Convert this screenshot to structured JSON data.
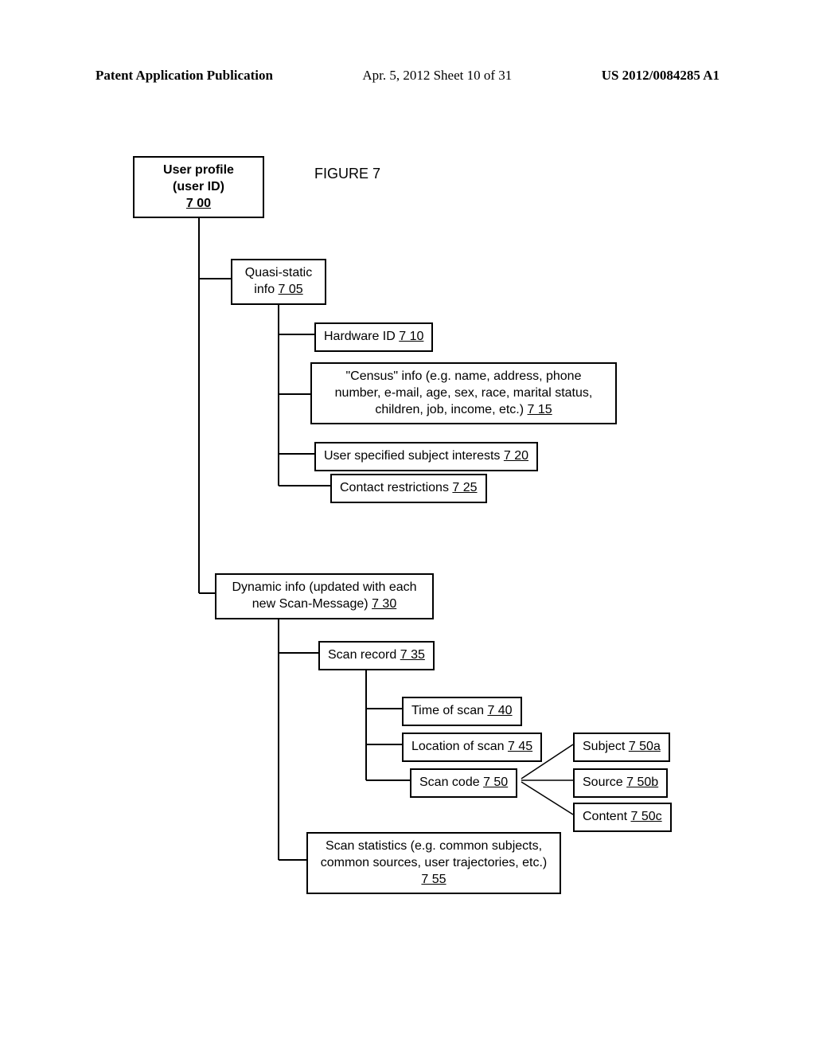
{
  "header": {
    "left": "Patent Application Publication",
    "center": "Apr. 5, 2012  Sheet 10 of 31",
    "right": "US 2012/0084285 A1"
  },
  "figure_title": "FIGURE 7",
  "boxes": {
    "root_line1": "User profile",
    "root_line2": "(user ID)",
    "root_ref": "7 00",
    "quasi_static": "Quasi-static",
    "quasi_static_line2": "info ",
    "quasi_static_ref": "7 05",
    "hardware_id": "Hardware ID ",
    "hardware_id_ref": "7 10",
    "census_line1": "\"Census\" info (e.g. name, address, phone",
    "census_line2": "number, e-mail, age, sex, race, marital status,",
    "census_line3": "children, job, income, etc.) ",
    "census_ref": "7 15",
    "user_interests": "User specified subject interests ",
    "user_interests_ref": "7 20",
    "contact_restrictions": "Contact restrictions ",
    "contact_restrictions_ref": "7 25",
    "dynamic_line1": "Dynamic info (updated with each",
    "dynamic_line2": "new Scan-Message) ",
    "dynamic_ref": "7 30",
    "scan_record": "Scan record ",
    "scan_record_ref": "7 35",
    "time_of_scan": "Time of scan ",
    "time_of_scan_ref": "7 40",
    "location_of_scan": "Location of scan ",
    "location_of_scan_ref": "7 45",
    "scan_code": "Scan code ",
    "scan_code_ref": "7 50",
    "subject": "Subject ",
    "subject_ref": "7 50a",
    "source": "Source ",
    "source_ref": "7 50b",
    "content": "Content ",
    "content_ref": "7 50c",
    "scan_stats_line1": "Scan statistics (e.g. common subjects,",
    "scan_stats_line2": "common sources, user trajectories, etc.)",
    "scan_stats_ref": "7 55"
  },
  "chart_data": {
    "type": "tree",
    "title": "FIGURE 7",
    "root": {
      "label": "User profile (user ID)",
      "ref": "7 00",
      "children": [
        {
          "label": "Quasi-static info",
          "ref": "7 05",
          "children": [
            {
              "label": "Hardware ID",
              "ref": "7 10"
            },
            {
              "label": "\"Census\" info (e.g. name, address, phone number, e-mail, age, sex, race, marital status, children, job, income, etc.)",
              "ref": "7 15"
            },
            {
              "label": "User specified subject interests",
              "ref": "7 20"
            },
            {
              "label": "Contact restrictions",
              "ref": "7 25"
            }
          ]
        },
        {
          "label": "Dynamic info (updated with each new Scan-Message)",
          "ref": "7 30",
          "children": [
            {
              "label": "Scan record",
              "ref": "7 35",
              "children": [
                {
                  "label": "Time of scan",
                  "ref": "7 40"
                },
                {
                  "label": "Location of scan",
                  "ref": "7 45"
                },
                {
                  "label": "Scan code",
                  "ref": "7 50",
                  "children": [
                    {
                      "label": "Subject",
                      "ref": "7 50a"
                    },
                    {
                      "label": "Source",
                      "ref": "7 50b"
                    },
                    {
                      "label": "Content",
                      "ref": "7 50c"
                    }
                  ]
                }
              ]
            },
            {
              "label": "Scan statistics (e.g. common subjects, common sources, user trajectories, etc.)",
              "ref": "7 55"
            }
          ]
        }
      ]
    }
  }
}
